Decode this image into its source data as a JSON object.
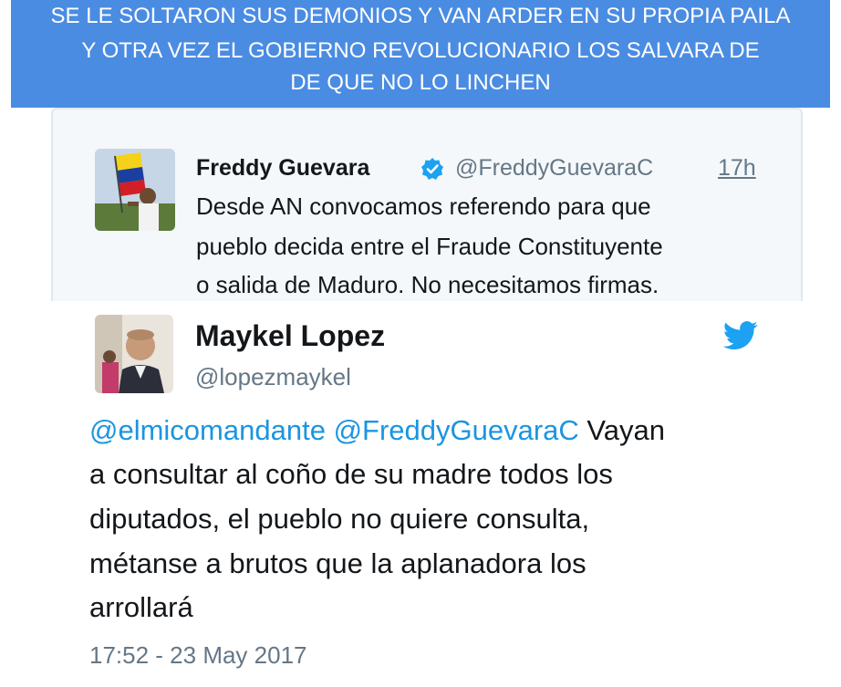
{
  "banner": {
    "line1": "SE LE SOLTARON SUS DEMONIOS Y VAN ARDER EN SU PROPIA PAILA",
    "line2": "Y  OTRA VEZ EL GOBIERNO REVOLUCIONARIO LOS SALVARA DE",
    "line3": "DE QUE NO LO LINCHEN",
    "background": "#4a8ce2"
  },
  "quoted_tweet": {
    "name": "Freddy Guevara",
    "handle": "@FreddyGuevaraC",
    "time": "17h",
    "verified_icon": "verified-badge-icon",
    "text_lines": [
      "Desde AN convocamos referendo para que",
      "pueblo decida entre el Fraude Constituyente",
      "o salida de Maduro. No necesitamos firmas."
    ]
  },
  "tweet": {
    "name": "Maykel Lopez",
    "handle": "@lopezmaykel",
    "logo_icon": "twitter-bird-icon",
    "mention1": "@elmicomandante",
    "mention2": "@FreddyGuevaraC",
    "line1_rest": " Vayan",
    "lines": [
      "a consultar al coño de su madre todos los",
      "diputados, el pueblo no quiere consulta,",
      "métanse a brutos que la aplanadora los",
      "arrollará"
    ],
    "timestamp": "17:52 - 23 May 2017"
  },
  "colors": {
    "link": "#1b95e0",
    "muted": "#657786",
    "text": "#14171a",
    "twitter_blue": "#1da1f2"
  }
}
